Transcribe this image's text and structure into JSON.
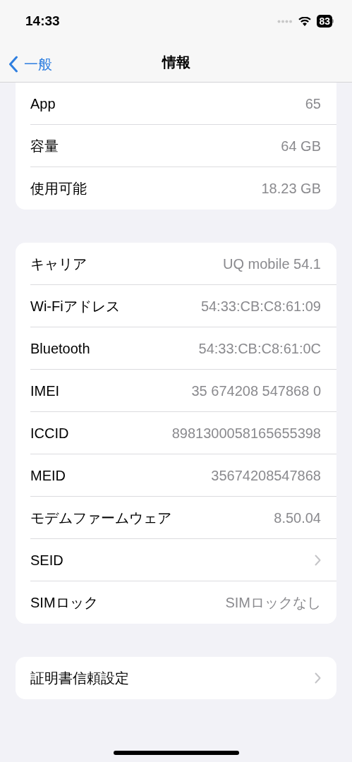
{
  "status_bar": {
    "time": "14:33",
    "battery": "83"
  },
  "nav": {
    "back": "一般",
    "title": "情報"
  },
  "sections": [
    {
      "rows": [
        {
          "kind": "value",
          "label": "App",
          "value": "65"
        },
        {
          "kind": "value",
          "label": "容量",
          "value": "64 GB"
        },
        {
          "kind": "value",
          "label": "使用可能",
          "value": "18.23 GB"
        }
      ]
    },
    {
      "rows": [
        {
          "kind": "value",
          "label": "キャリア",
          "value": "UQ mobile 54.1"
        },
        {
          "kind": "value",
          "label": "Wi-Fiアドレス",
          "value": "54:33:CB:C8:61:09"
        },
        {
          "kind": "value",
          "label": "Bluetooth",
          "value": "54:33:CB:C8:61:0C"
        },
        {
          "kind": "value",
          "label": "IMEI",
          "value": "35 674208 547868 0"
        },
        {
          "kind": "value",
          "label": "ICCID",
          "value": "8981300058165655398"
        },
        {
          "kind": "value",
          "label": "MEID",
          "value": "35674208547868"
        },
        {
          "kind": "value",
          "label": "モデムファームウェア",
          "value": "8.50.04"
        },
        {
          "kind": "link",
          "label": "SEID"
        },
        {
          "kind": "value",
          "label": "SIMロック",
          "value": "SIMロックなし"
        }
      ]
    },
    {
      "rows": [
        {
          "kind": "link",
          "label": "証明書信頼設定"
        }
      ]
    }
  ]
}
